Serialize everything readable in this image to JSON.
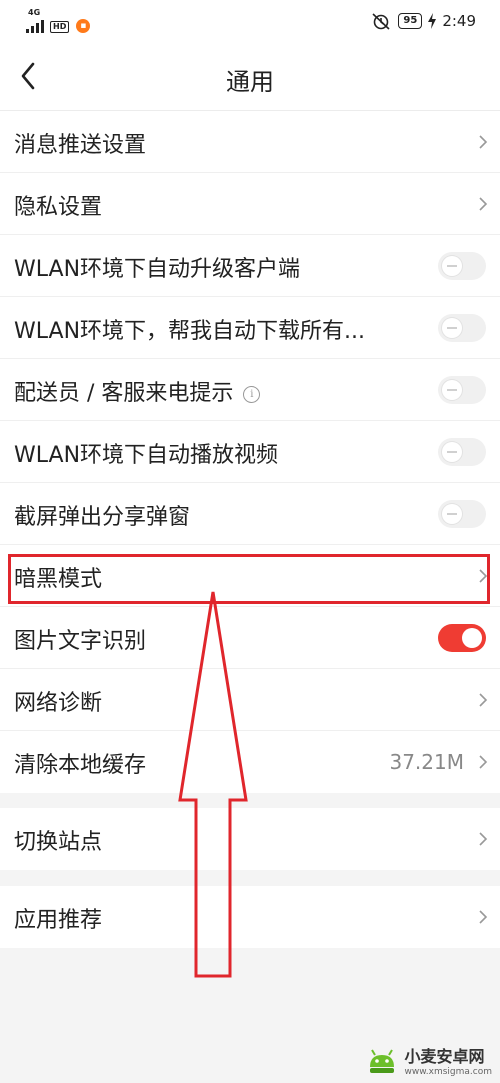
{
  "status_bar": {
    "network": "4G",
    "hd": "HD",
    "battery": "95",
    "time": "2:49"
  },
  "header": {
    "title": "通用"
  },
  "settings": {
    "push": "消息推送设置",
    "privacy": "隐私设置",
    "wlan_upgrade": "WLAN环境下自动升级客户端",
    "wlan_download": "WLAN环境下，帮我自动下载所有...",
    "courier_call": "配送员 / 客服来电提示",
    "wlan_autoplay": "WLAN环境下自动播放视频",
    "screenshot_share": "截屏弹出分享弹窗",
    "dark_mode": "暗黑模式",
    "image_text": "图片文字识别",
    "network_diag": "网络诊断",
    "clear_cache": "清除本地缓存",
    "cache_size": "37.21M",
    "switch_site": "切换站点",
    "app_recommend": "应用推荐"
  },
  "toggles": {
    "wlan_upgrade": false,
    "wlan_download": false,
    "courier_call": false,
    "wlan_autoplay": false,
    "screenshot_share": false,
    "image_text": true
  },
  "colors": {
    "toggle_on": "#ef3c33",
    "highlight": "#e0262c",
    "background": "#f4f4f4"
  },
  "watermark": {
    "name": "小麦安卓网",
    "url": "www.xmsigma.com"
  }
}
